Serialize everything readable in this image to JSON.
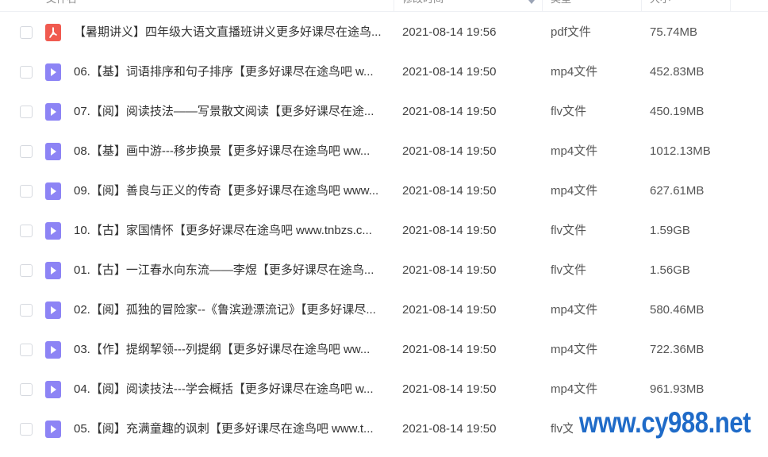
{
  "header": {
    "name_label": "文件名",
    "date_label": "修改时间",
    "type_label": "类型",
    "size_label": "大小"
  },
  "files": [
    {
      "name": "【暑期讲义】四年级大语文直播班讲义更多好课尽在途鸟...",
      "date": "2021-08-14 19:56",
      "type": "pdf文件",
      "size": "75.74MB",
      "icon": "pdf-icon"
    },
    {
      "name": "06.【基】词语排序和句子排序【更多好课尽在途鸟吧 w...",
      "date": "2021-08-14 19:50",
      "type": "mp4文件",
      "size": "452.83MB",
      "icon": "video-icon"
    },
    {
      "name": "07.【阅】阅读技法——写景散文阅读【更多好课尽在途...",
      "date": "2021-08-14 19:50",
      "type": "flv文件",
      "size": "450.19MB",
      "icon": "video-icon"
    },
    {
      "name": "08.【基】画中游---移步换景【更多好课尽在途鸟吧 ww...",
      "date": "2021-08-14 19:50",
      "type": "mp4文件",
      "size": "1012.13MB",
      "icon": "video-icon"
    },
    {
      "name": "09.【阅】善良与正义的传奇【更多好课尽在途鸟吧 www...",
      "date": "2021-08-14 19:50",
      "type": "mp4文件",
      "size": "627.61MB",
      "icon": "video-icon"
    },
    {
      "name": "10.【古】家国情怀【更多好课尽在途鸟吧 www.tnbzs.c...",
      "date": "2021-08-14 19:50",
      "type": "flv文件",
      "size": "1.59GB",
      "icon": "video-icon"
    },
    {
      "name": "01.【古】一江春水向东流——李煜【更多好课尽在途鸟...",
      "date": "2021-08-14 19:50",
      "type": "flv文件",
      "size": "1.56GB",
      "icon": "video-icon"
    },
    {
      "name": "02.【阅】孤独的冒险家--《鲁滨逊漂流记》【更多好课尽...",
      "date": "2021-08-14 19:50",
      "type": "mp4文件",
      "size": "580.46MB",
      "icon": "video-icon"
    },
    {
      "name": "03.【作】提纲挈领---列提纲【更多好课尽在途鸟吧 ww...",
      "date": "2021-08-14 19:50",
      "type": "mp4文件",
      "size": "722.36MB",
      "icon": "video-icon"
    },
    {
      "name": "04.【阅】阅读技法---学会概括【更多好课尽在途鸟吧 w...",
      "date": "2021-08-14 19:50",
      "type": "mp4文件",
      "size": "961.93MB",
      "icon": "video-icon"
    },
    {
      "name": "05.【阅】充满童趣的讽刺【更多好课尽在途鸟吧 www.t...",
      "date": "2021-08-14 19:50",
      "type": "flv文件",
      "size": "",
      "icon": "video-icon"
    }
  ],
  "watermark": {
    "text": "www.cy988.net"
  },
  "colors": {
    "video_icon": "#8d84f5",
    "pdf_icon": "#f05a50",
    "watermark": "#1f6bc8"
  }
}
